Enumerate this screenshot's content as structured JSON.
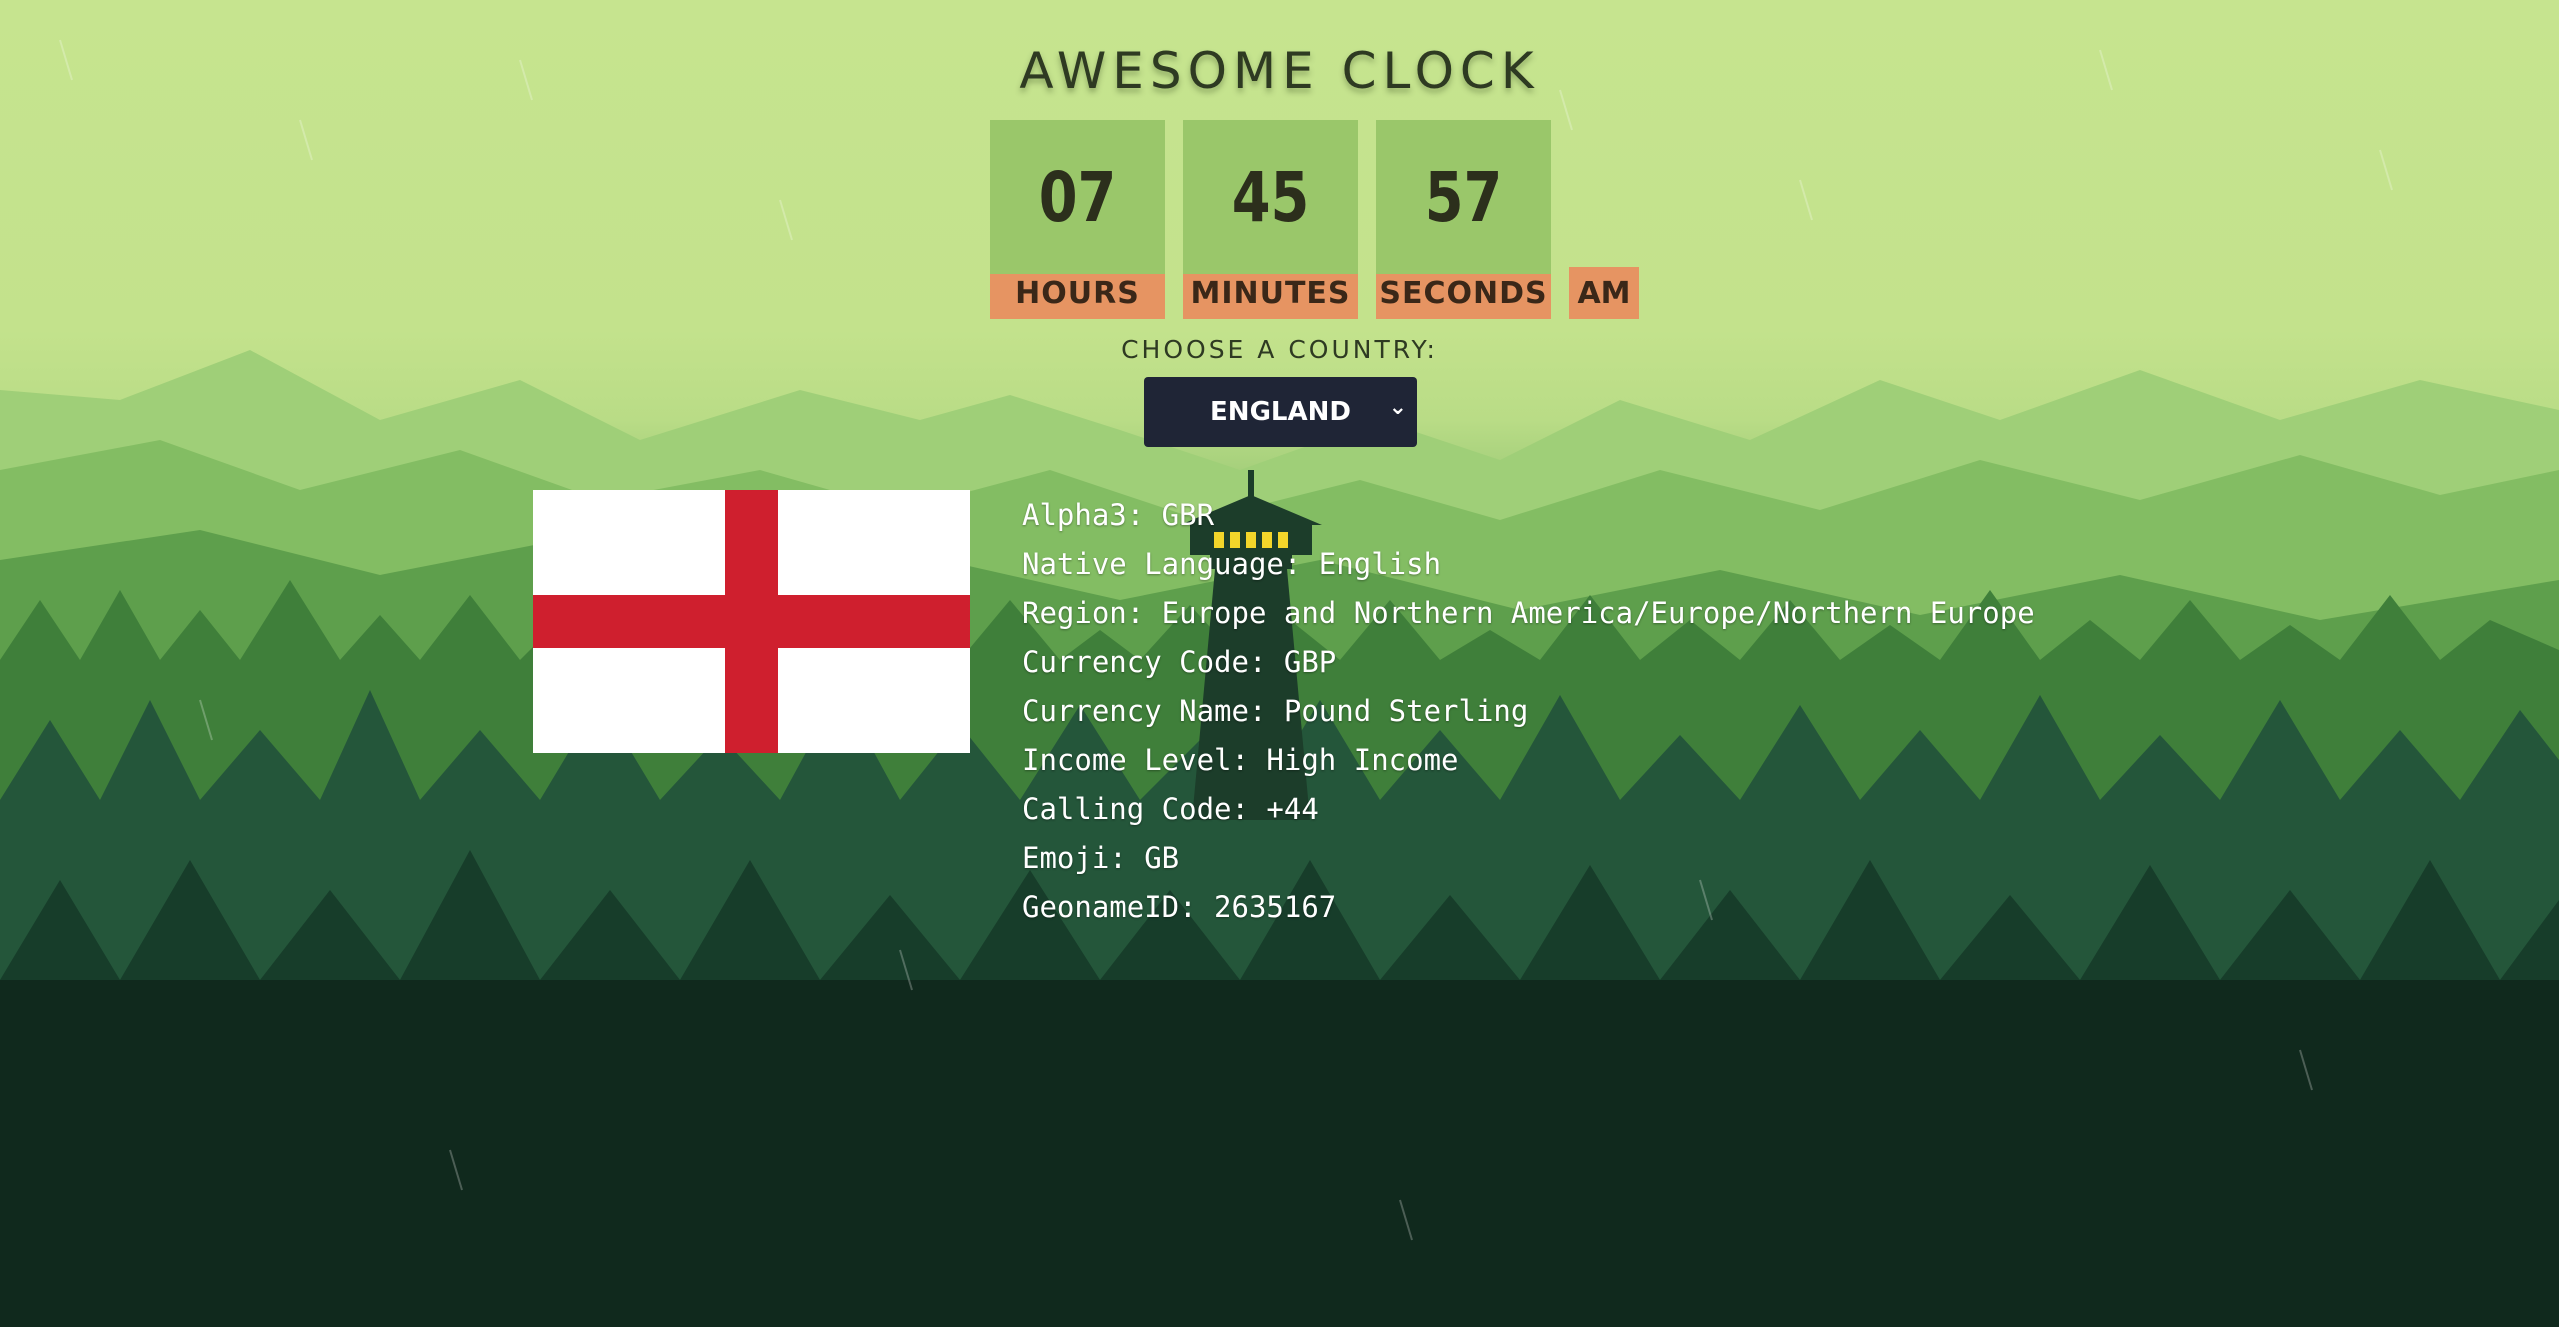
{
  "app": {
    "title": "AWESOME CLOCK"
  },
  "clock": {
    "hours": "07",
    "hours_label": "HOURS",
    "minutes": "45",
    "minutes_label": "MINUTES",
    "seconds": "57",
    "seconds_label": "SECONDS",
    "period": "AM"
  },
  "country_picker": {
    "label": "CHOOSE A COUNTRY:",
    "selected": "ENGLAND",
    "chevron_icon": "chevron-down-icon"
  },
  "country_info": {
    "flag_icon": "england-flag",
    "rows": [
      "Alpha3: GBR",
      "Native Language: English",
      "Region: Europe and Northern America/Europe/Northern Europe",
      "Currency Code: GBP",
      "Currency Name: Pound Sterling",
      "Income Level: High Income",
      "Calling Code: +44",
      "Emoji: GB",
      "GeonameID: 2635167"
    ]
  },
  "colors": {
    "sky": "#c6e48f",
    "clock_digit_bg": "#9ac76a",
    "clock_label_bg": "#e69462",
    "select_bg": "#1f2536",
    "flag_red": "#cf1f2e"
  }
}
